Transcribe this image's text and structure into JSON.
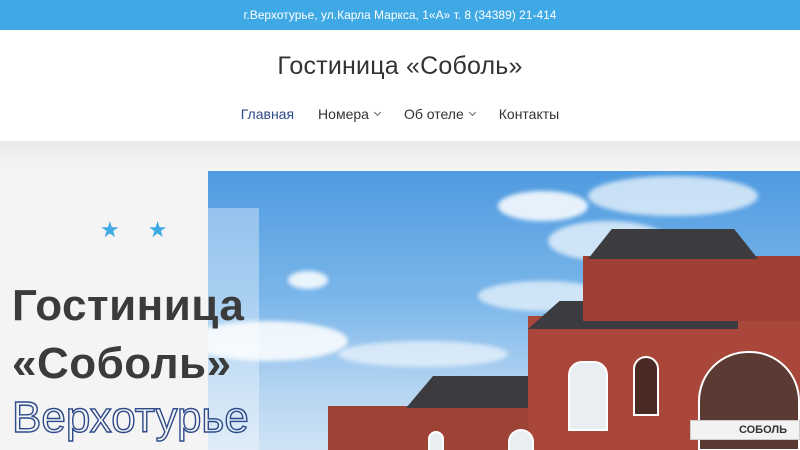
{
  "topbar": {
    "address": "г.Верхотурье, ул.Карла Маркса, 1«А» т. 8 (34389) 21-414"
  },
  "header": {
    "site_title": "Гостиница «Соболь»",
    "nav": [
      {
        "label": "Главная",
        "has_dropdown": false,
        "active": true
      },
      {
        "label": "Номера",
        "has_dropdown": true,
        "active": false
      },
      {
        "label": "Об отеле",
        "has_dropdown": true,
        "active": false
      },
      {
        "label": "Контакты",
        "has_dropdown": false,
        "active": false
      }
    ]
  },
  "hero": {
    "stars": [
      "★",
      "★"
    ],
    "title_line1": "Гостиница",
    "title_line2": "«Соболь»",
    "title_line3": "Верхотурье",
    "sign_text": "СОБОЛЬ"
  },
  "colors": {
    "topbar": "#3fa9e6",
    "accent": "#2d4a8a",
    "star": "#3fa9e6",
    "text": "#333333"
  }
}
